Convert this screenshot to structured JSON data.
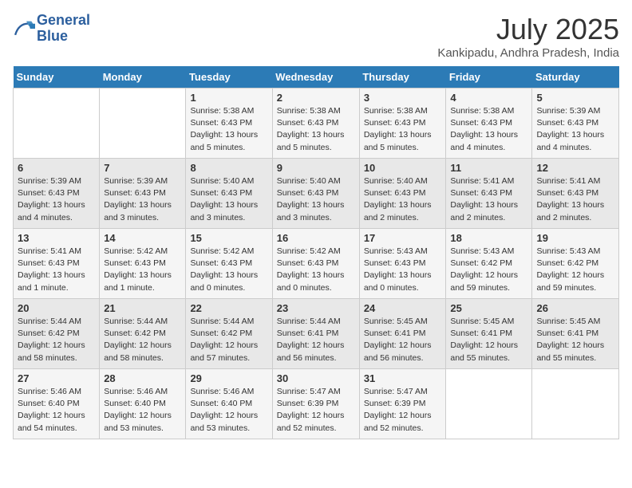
{
  "header": {
    "logo_line1": "General",
    "logo_line2": "Blue",
    "month_year": "July 2025",
    "location": "Kankipadu, Andhra Pradesh, India"
  },
  "weekdays": [
    "Sunday",
    "Monday",
    "Tuesday",
    "Wednesday",
    "Thursday",
    "Friday",
    "Saturday"
  ],
  "weeks": [
    [
      {
        "day": "",
        "info": ""
      },
      {
        "day": "",
        "info": ""
      },
      {
        "day": "1",
        "info": "Sunrise: 5:38 AM\nSunset: 6:43 PM\nDaylight: 13 hours and 5 minutes."
      },
      {
        "day": "2",
        "info": "Sunrise: 5:38 AM\nSunset: 6:43 PM\nDaylight: 13 hours and 5 minutes."
      },
      {
        "day": "3",
        "info": "Sunrise: 5:38 AM\nSunset: 6:43 PM\nDaylight: 13 hours and 5 minutes."
      },
      {
        "day": "4",
        "info": "Sunrise: 5:38 AM\nSunset: 6:43 PM\nDaylight: 13 hours and 4 minutes."
      },
      {
        "day": "5",
        "info": "Sunrise: 5:39 AM\nSunset: 6:43 PM\nDaylight: 13 hours and 4 minutes."
      }
    ],
    [
      {
        "day": "6",
        "info": "Sunrise: 5:39 AM\nSunset: 6:43 PM\nDaylight: 13 hours and 4 minutes."
      },
      {
        "day": "7",
        "info": "Sunrise: 5:39 AM\nSunset: 6:43 PM\nDaylight: 13 hours and 3 minutes."
      },
      {
        "day": "8",
        "info": "Sunrise: 5:40 AM\nSunset: 6:43 PM\nDaylight: 13 hours and 3 minutes."
      },
      {
        "day": "9",
        "info": "Sunrise: 5:40 AM\nSunset: 6:43 PM\nDaylight: 13 hours and 3 minutes."
      },
      {
        "day": "10",
        "info": "Sunrise: 5:40 AM\nSunset: 6:43 PM\nDaylight: 13 hours and 2 minutes."
      },
      {
        "day": "11",
        "info": "Sunrise: 5:41 AM\nSunset: 6:43 PM\nDaylight: 13 hours and 2 minutes."
      },
      {
        "day": "12",
        "info": "Sunrise: 5:41 AM\nSunset: 6:43 PM\nDaylight: 13 hours and 2 minutes."
      }
    ],
    [
      {
        "day": "13",
        "info": "Sunrise: 5:41 AM\nSunset: 6:43 PM\nDaylight: 13 hours and 1 minute."
      },
      {
        "day": "14",
        "info": "Sunrise: 5:42 AM\nSunset: 6:43 PM\nDaylight: 13 hours and 1 minute."
      },
      {
        "day": "15",
        "info": "Sunrise: 5:42 AM\nSunset: 6:43 PM\nDaylight: 13 hours and 0 minutes."
      },
      {
        "day": "16",
        "info": "Sunrise: 5:42 AM\nSunset: 6:43 PM\nDaylight: 13 hours and 0 minutes."
      },
      {
        "day": "17",
        "info": "Sunrise: 5:43 AM\nSunset: 6:43 PM\nDaylight: 13 hours and 0 minutes."
      },
      {
        "day": "18",
        "info": "Sunrise: 5:43 AM\nSunset: 6:42 PM\nDaylight: 12 hours and 59 minutes."
      },
      {
        "day": "19",
        "info": "Sunrise: 5:43 AM\nSunset: 6:42 PM\nDaylight: 12 hours and 59 minutes."
      }
    ],
    [
      {
        "day": "20",
        "info": "Sunrise: 5:44 AM\nSunset: 6:42 PM\nDaylight: 12 hours and 58 minutes."
      },
      {
        "day": "21",
        "info": "Sunrise: 5:44 AM\nSunset: 6:42 PM\nDaylight: 12 hours and 58 minutes."
      },
      {
        "day": "22",
        "info": "Sunrise: 5:44 AM\nSunset: 6:42 PM\nDaylight: 12 hours and 57 minutes."
      },
      {
        "day": "23",
        "info": "Sunrise: 5:44 AM\nSunset: 6:41 PM\nDaylight: 12 hours and 56 minutes."
      },
      {
        "day": "24",
        "info": "Sunrise: 5:45 AM\nSunset: 6:41 PM\nDaylight: 12 hours and 56 minutes."
      },
      {
        "day": "25",
        "info": "Sunrise: 5:45 AM\nSunset: 6:41 PM\nDaylight: 12 hours and 55 minutes."
      },
      {
        "day": "26",
        "info": "Sunrise: 5:45 AM\nSunset: 6:41 PM\nDaylight: 12 hours and 55 minutes."
      }
    ],
    [
      {
        "day": "27",
        "info": "Sunrise: 5:46 AM\nSunset: 6:40 PM\nDaylight: 12 hours and 54 minutes."
      },
      {
        "day": "28",
        "info": "Sunrise: 5:46 AM\nSunset: 6:40 PM\nDaylight: 12 hours and 53 minutes."
      },
      {
        "day": "29",
        "info": "Sunrise: 5:46 AM\nSunset: 6:40 PM\nDaylight: 12 hours and 53 minutes."
      },
      {
        "day": "30",
        "info": "Sunrise: 5:47 AM\nSunset: 6:39 PM\nDaylight: 12 hours and 52 minutes."
      },
      {
        "day": "31",
        "info": "Sunrise: 5:47 AM\nSunset: 6:39 PM\nDaylight: 12 hours and 52 minutes."
      },
      {
        "day": "",
        "info": ""
      },
      {
        "day": "",
        "info": ""
      }
    ]
  ]
}
